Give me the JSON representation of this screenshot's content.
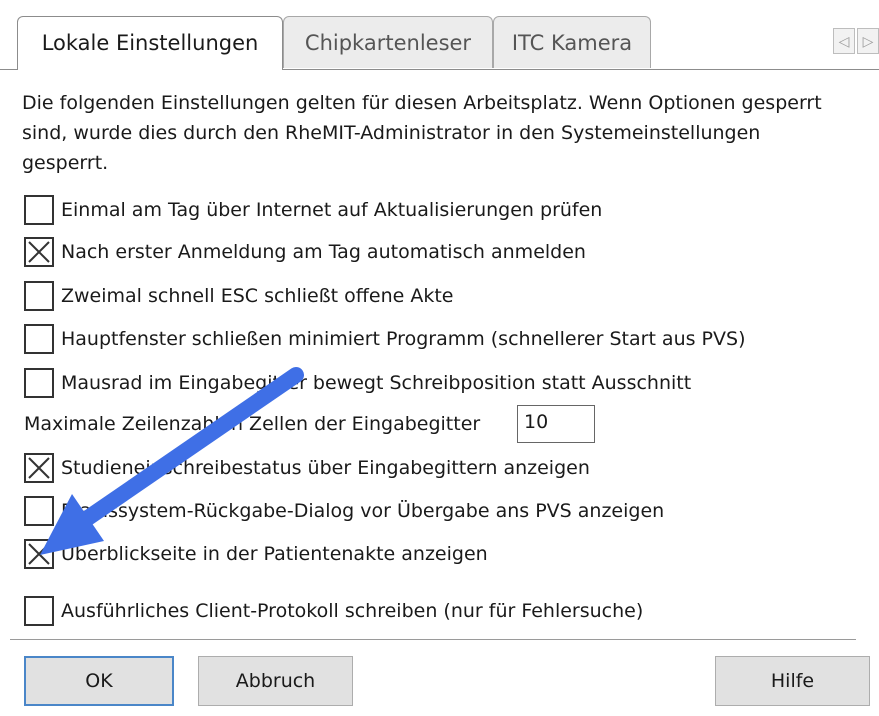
{
  "tabs": [
    {
      "label": "Lokale Einstellungen",
      "active": true
    },
    {
      "label": "Chipkartenleser",
      "active": false
    },
    {
      "label": "ITC Kamera",
      "active": false
    }
  ],
  "tab_scroll": {
    "left_glyph": "◁",
    "right_glyph": "▷"
  },
  "description": "Die folgenden Einstellungen gelten für diesen Arbeitsplatz. Wenn Optionen gesperrt sind, wurde dies durch den RheMIT-Administrator in den Systemeinstellungen gesperrt.",
  "options": [
    {
      "label": "Einmal am Tag über Internet auf Aktualisierungen prüfen",
      "checked": false
    },
    {
      "label": "Nach erster Anmeldung am Tag automatisch anmelden",
      "checked": true
    },
    {
      "label": "Zweimal schnell ESC schließt offene Akte",
      "checked": false
    },
    {
      "label": "Hauptfenster schließen minimiert Programm (schnellerer Start aus PVS)",
      "checked": false
    },
    {
      "label": "Mausrad im Eingabegitter bewegt Schreibposition statt Ausschnitt",
      "checked": false
    },
    {
      "label": "Studieneinschreibestatus über Eingabegittern anzeigen",
      "checked": true
    },
    {
      "label": "Praxissystem-Rückgabe-Dialog vor Übergabe ans PVS anzeigen",
      "checked": false
    },
    {
      "label": "Überblickseite in der Patientenakte anzeigen",
      "checked": true
    },
    {
      "label": "Ausführliches Client-Protokoll schreiben (nur für Fehlersuche)",
      "checked": false
    }
  ],
  "max_lines": {
    "label": "Maximale Zeilenzahl in Zellen der Eingabegitter",
    "value": "10"
  },
  "buttons": {
    "ok": "OK",
    "cancel": "Abbruch",
    "help": "Hilfe"
  },
  "colors": {
    "accent": "#4a86c8",
    "annotation_arrow": "#3f6fe6"
  }
}
